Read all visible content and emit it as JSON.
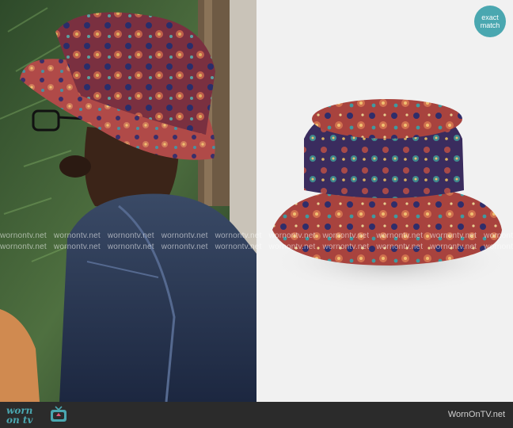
{
  "badge": {
    "line1": "exact",
    "line2": "match"
  },
  "watermark": {
    "text": "wornontv.net"
  },
  "footer": {
    "logo_top": "worn",
    "logo_bottom": "on tv",
    "site_name": "WornOnTV.net"
  },
  "colors": {
    "accent": "#4aa7b0",
    "footer_bg": "#2b2b2b",
    "product_bg": "#f1f1f1"
  },
  "icons": [
    "tv-icon"
  ]
}
